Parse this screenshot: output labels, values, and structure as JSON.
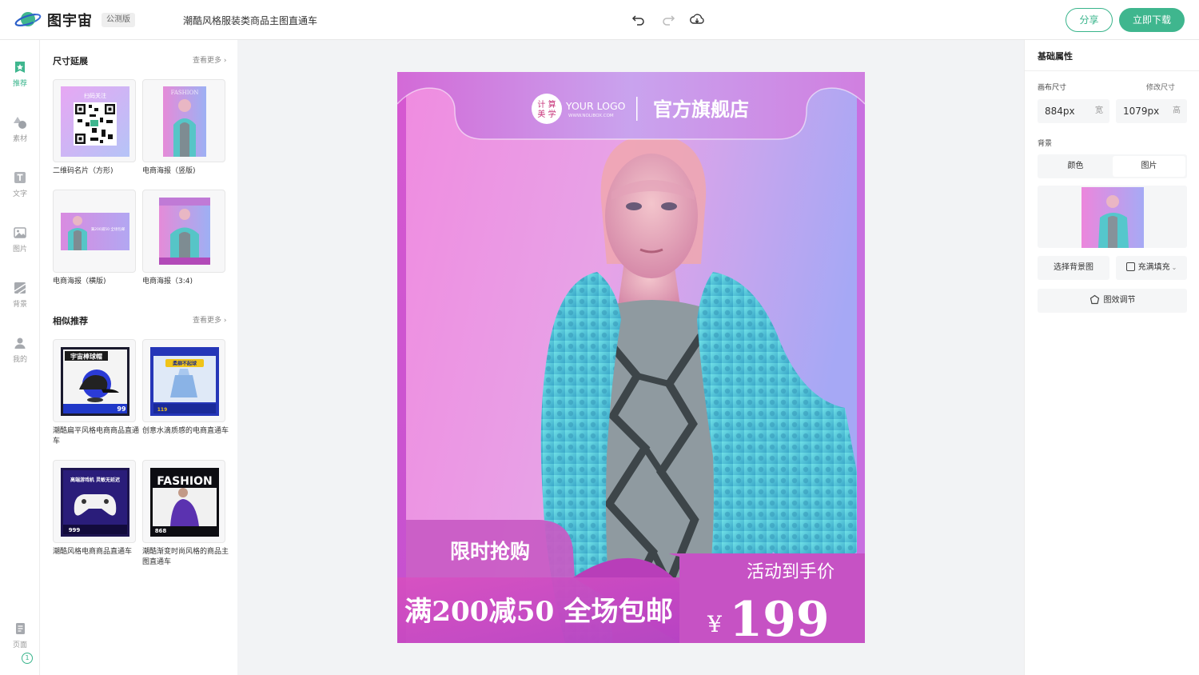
{
  "app": {
    "name": "图宇宙",
    "badge": "公测版",
    "doc_title": "潮酷风格服装类商品主图直通车",
    "share_label": "分享",
    "download_label": "立即下载",
    "accent_color": "#3fb68e"
  },
  "rail": {
    "items": [
      {
        "label": "推荐",
        "icon": "recommend-icon"
      },
      {
        "label": "素材",
        "icon": "shapes-icon"
      },
      {
        "label": "文字",
        "icon": "text-icon"
      },
      {
        "label": "图片",
        "icon": "image-icon"
      },
      {
        "label": "背景",
        "icon": "background-icon"
      },
      {
        "label": "我的",
        "icon": "user-icon"
      }
    ],
    "pages_label": "页面",
    "pages_count": "1"
  },
  "panel": {
    "size_section_title": "尺寸延展",
    "see_more": "查看更多",
    "size_items": [
      {
        "caption": "二维码名片（方形)",
        "thumb_text": "扫码关注"
      },
      {
        "caption": "电商海报（竖版)",
        "thumb_text": "FASHION"
      },
      {
        "caption": "电商海报（横版)",
        "thumb_text": "满200减50 全场包邮"
      },
      {
        "caption": "电商海报（3:4)",
        "thumb_text": ""
      }
    ],
    "similar_section_title": "相似推荐",
    "similar_items": [
      {
        "caption": "潮酷扁平风格电商商品直通车",
        "thumb_title": "宇宙棒球帽",
        "thumb_price": "99"
      },
      {
        "caption": "创意水滴质感的电商直通车",
        "thumb_title": "柔柳不起球",
        "thumb_price": "119"
      },
      {
        "caption": "潮酷风格电商商品直通车",
        "thumb_title": "高端游戏机 灵敏无延迟",
        "thumb_price": "999"
      },
      {
        "caption": "潮酷渐变时尚风格的商品主图直通车",
        "thumb_title": "FASHION",
        "thumb_price": "868"
      }
    ]
  },
  "poster": {
    "logo_cn_top": "计 算",
    "logo_cn_bottom": "美 学",
    "logo_en": "YOUR LOGO",
    "logo_url": "WWW.NOLIBOX.COM",
    "store_name": "官方旗舰店",
    "flash_sale": "限时抢购",
    "promo": "满200减50 全场包邮",
    "price_caption": "活动到手价",
    "currency": "¥",
    "price": "199"
  },
  "props": {
    "title": "基础属性",
    "canvas_size_label": "画布尺寸",
    "modify_size_link": "修改尺寸",
    "width_value": "884px",
    "width_unit": "宽",
    "height_value": "1079px",
    "height_unit": "高",
    "background_label": "背景",
    "tab_color": "颜色",
    "tab_image": "图片",
    "choose_bg_label": "选择背景图",
    "fill_mode_label": "充满填充",
    "effect_label": "图效调节"
  }
}
